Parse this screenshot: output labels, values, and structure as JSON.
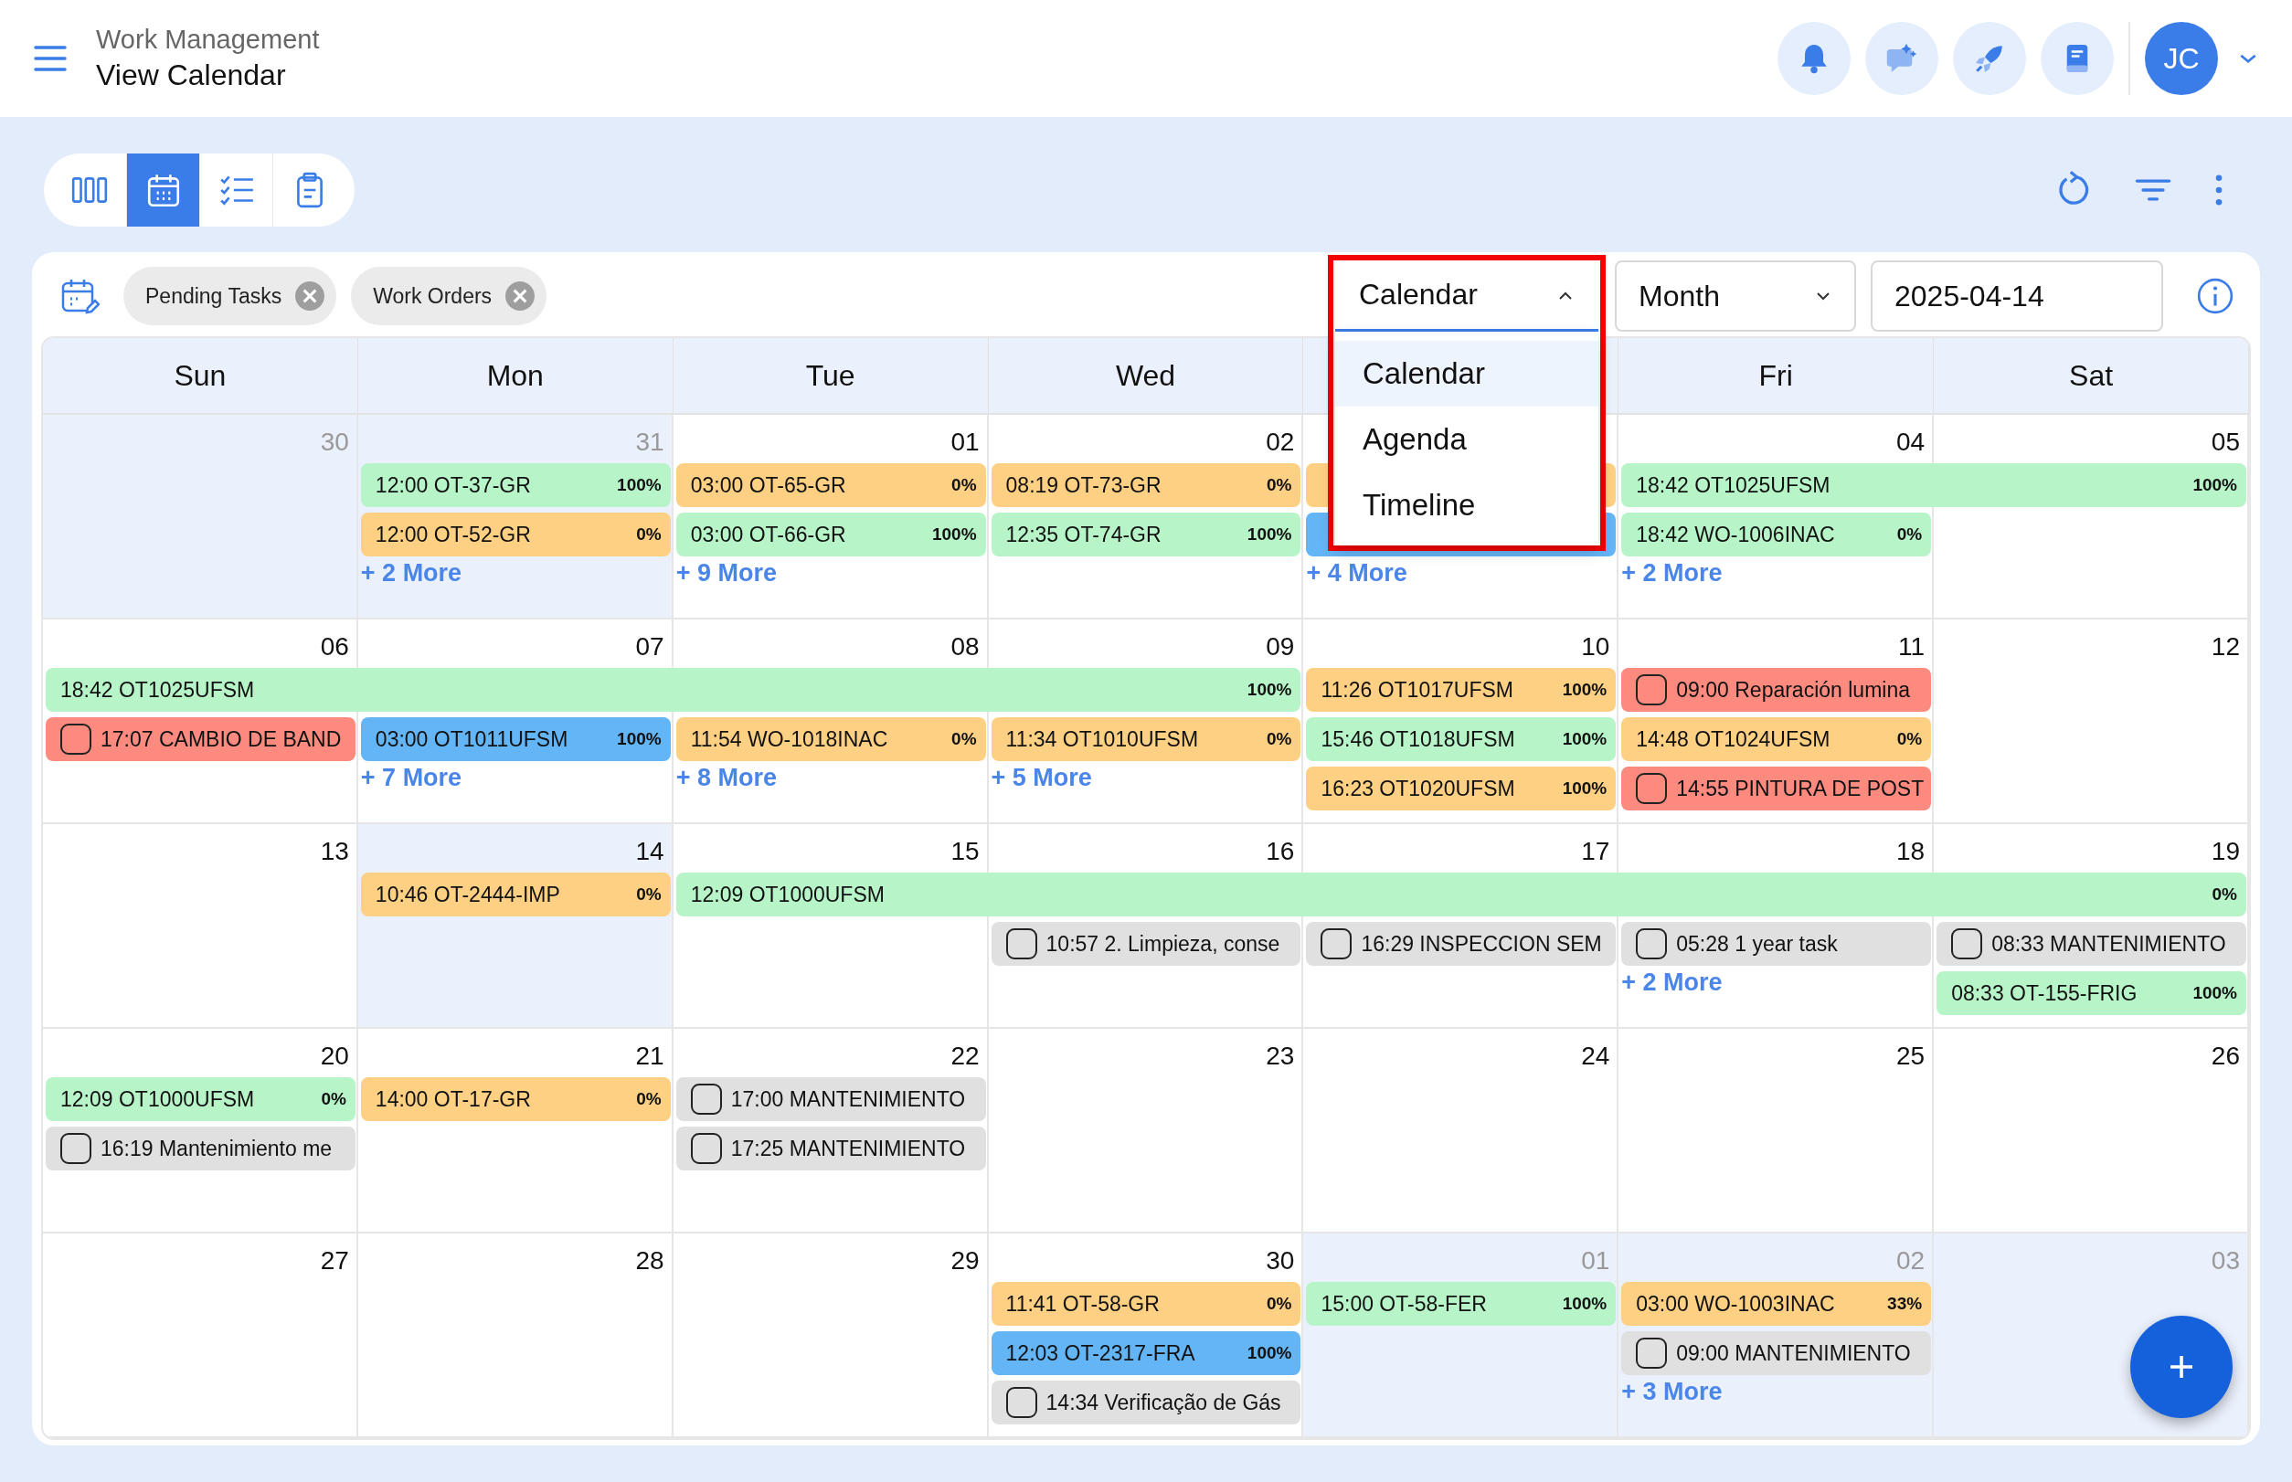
{
  "header": {
    "section": "Work Management",
    "title": "View Calendar",
    "avatar": "JC"
  },
  "view_buttons": [
    {
      "kind": "board",
      "selected": false
    },
    {
      "kind": "calendar",
      "selected": true
    },
    {
      "kind": "checklist",
      "selected": false
    },
    {
      "kind": "clipboard",
      "selected": false
    }
  ],
  "filter_chips": [
    {
      "label": "Pending Tasks"
    },
    {
      "label": "Work Orders"
    }
  ],
  "view_select": {
    "value": "Calendar",
    "expanded": true,
    "options": [
      {
        "label": "Calendar",
        "selected": true
      },
      {
        "label": "Agenda",
        "selected": false
      },
      {
        "label": "Timeline",
        "selected": false
      }
    ]
  },
  "range_select": {
    "value": "Month"
  },
  "date_field": {
    "value": "2025-04-14"
  },
  "weekdays": [
    {
      "kind": "label",
      "label": "Sun"
    },
    {
      "kind": "label",
      "label": "Mon"
    },
    {
      "kind": "label",
      "label": "Tue"
    },
    {
      "kind": "label",
      "label": "Wed"
    },
    {
      "kind": "covered"
    },
    {
      "kind": "label",
      "label": "Fri"
    },
    {
      "kind": "label",
      "label": "Sat"
    }
  ],
  "weeks": [
    {
      "days": [
        {
          "date": "30",
          "muted": true,
          "shaded": true
        },
        {
          "date": "31",
          "muted": true,
          "shaded": true,
          "events": [
            {
              "kind": "work_order",
              "color": "#b7f5c9",
              "title": "12:00 OT-37-GR",
              "percent": "100%"
            },
            {
              "kind": "work_order",
              "color": "#fdd083",
              "title": "12:00 OT-52-GR",
              "percent": "0%"
            }
          ],
          "more": "+ 2 More"
        },
        {
          "date": "01",
          "muted": false,
          "shaded": false,
          "events": [
            {
              "kind": "work_order",
              "color": "#fdd083",
              "title": "03:00 OT-65-GR",
              "percent": "0%"
            },
            {
              "kind": "work_order",
              "color": "#b7f5c9",
              "title": "03:00 OT-66-GR",
              "percent": "100%"
            }
          ],
          "more": "+ 9 More"
        },
        {
          "date": "02",
          "muted": false,
          "shaded": false,
          "events": [
            {
              "kind": "work_order",
              "color": "#fdd083",
              "title": "08:19 OT-73-GR",
              "percent": "0%"
            },
            {
              "kind": "work_order",
              "color": "#b7f5c9",
              "title": "12:35 OT-74-GR",
              "percent": "100%"
            }
          ]
        },
        {
          "shaded": false,
          "events": [
            {
              "kind": "work_order",
              "color": "#fdd083"
            },
            {
              "kind": "work_order",
              "color": "#64b5f6"
            }
          ],
          "more": "+ 4 More"
        },
        {
          "date": "04",
          "muted": false,
          "shaded": false,
          "events": [
            {
              "kind": "work_order",
              "color": "#b7f5c9",
              "title": "18:42 OT1025UFSM",
              "percent": "100%"
            },
            {
              "kind": "work_order",
              "color": "#b7f5c9",
              "title": "18:42 WO-1006INAC",
              "percent": "0%"
            }
          ],
          "more": "+ 2 More"
        },
        {
          "date": "05",
          "muted": false,
          "shaded": false,
          "continues": true
        }
      ]
    },
    {
      "days": [
        {
          "date": "06",
          "muted": false,
          "shaded": false,
          "events": [
            {
              "kind": "work_order",
              "color": "#b7f5c9",
              "title": "18:42 OT1025UFSM",
              "percent": "100%"
            },
            {
              "kind": "task",
              "color": "#fc8a7e",
              "title": "17:07 CAMBIO DE BAND",
              "checked": false
            }
          ]
        },
        {
          "date": "07",
          "muted": false,
          "shaded": false,
          "continues": true,
          "events": [
            {
              "kind": "work_order",
              "color": "#64b5f6",
              "title": "03:00 OT1011UFSM",
              "percent": "100%"
            }
          ],
          "more": "+ 7 More"
        },
        {
          "date": "08",
          "muted": false,
          "shaded": false,
          "continues": true,
          "events": [
            {
              "kind": "work_order",
              "color": "#fdd083",
              "title": "11:54 WO-1018INAC",
              "percent": "0%"
            }
          ],
          "more": "+ 8 More"
        },
        {
          "date": "09",
          "muted": false,
          "shaded": false,
          "continues": true,
          "events": [
            {
              "kind": "work_order",
              "color": "#fdd083",
              "title": "11:34 OT1010UFSM",
              "percent": "0%"
            }
          ],
          "more": "+ 5 More"
        },
        {
          "date": "10",
          "muted": false,
          "shaded": false,
          "events": [
            {
              "kind": "work_order",
              "color": "#fdd083",
              "title": "11:26 OT1017UFSM",
              "percent": "100%"
            },
            {
              "kind": "work_order",
              "color": "#b7f5c9",
              "title": "15:46 OT1018UFSM",
              "percent": "100%"
            },
            {
              "kind": "work_order",
              "color": "#fdd083",
              "title": "16:23 OT1020UFSM",
              "percent": "100%"
            }
          ]
        },
        {
          "date": "11",
          "muted": false,
          "shaded": false,
          "events": [
            {
              "kind": "task",
              "color": "#fc8a7e",
              "title": "09:00 Reparación lumina",
              "checked": false
            },
            {
              "kind": "work_order",
              "color": "#fdd083",
              "title": "14:48 OT1024UFSM",
              "percent": "0%"
            },
            {
              "kind": "task",
              "color": "#fc8a7e",
              "title": "14:55 PINTURA DE POST",
              "checked": false
            }
          ]
        },
        {
          "date": "12",
          "muted": false,
          "shaded": false
        }
      ]
    },
    {
      "days": [
        {
          "date": "13",
          "muted": false,
          "shaded": false
        },
        {
          "date": "14",
          "muted": false,
          "shaded": true,
          "events": [
            {
              "kind": "work_order",
              "color": "#fdd083",
              "title": "10:46 OT-2444-IMP",
              "percent": "0%"
            }
          ]
        },
        {
          "date": "15",
          "muted": false,
          "shaded": false,
          "events": [
            {
              "kind": "work_order",
              "color": "#b7f5c9",
              "title": "12:09 OT1000UFSM",
              "percent": "0%"
            }
          ]
        },
        {
          "date": "16",
          "muted": false,
          "shaded": false,
          "continues": true,
          "events": [
            {
              "kind": "task",
              "color": "#e0e0e0",
              "title": "10:57 2. Limpieza, conse",
              "checked": false
            }
          ]
        },
        {
          "date": "17",
          "muted": false,
          "shaded": false,
          "continues": true,
          "events": [
            {
              "kind": "task",
              "color": "#e0e0e0",
              "title": "16:29 INSPECCION SEM",
              "checked": false
            }
          ]
        },
        {
          "date": "18",
          "muted": false,
          "shaded": false,
          "continues": true,
          "events": [
            {
              "kind": "task",
              "color": "#e0e0e0",
              "title": "05:28 1 year task",
              "checked": false
            }
          ],
          "more": "+ 2 More"
        },
        {
          "date": "19",
          "muted": false,
          "shaded": false,
          "continues": true,
          "events": [
            {
              "kind": "task",
              "color": "#e0e0e0",
              "title": "08:33 MANTENIMIENTO",
              "checked": false
            },
            {
              "kind": "work_order",
              "color": "#b7f5c9",
              "title": "08:33 OT-155-FRIG",
              "percent": "100%"
            }
          ]
        }
      ]
    },
    {
      "days": [
        {
          "date": "20",
          "muted": false,
          "shaded": false,
          "events": [
            {
              "kind": "work_order",
              "color": "#b7f5c9",
              "title": "12:09 OT1000UFSM",
              "percent": "0%"
            },
            {
              "kind": "task",
              "color": "#e0e0e0",
              "title": "16:19 Mantenimiento me",
              "checked": false
            }
          ]
        },
        {
          "date": "21",
          "muted": false,
          "shaded": false,
          "events": [
            {
              "kind": "work_order",
              "color": "#fdd083",
              "title": "14:00 OT-17-GR",
              "percent": "0%"
            }
          ]
        },
        {
          "date": "22",
          "muted": false,
          "shaded": false,
          "events": [
            {
              "kind": "task",
              "color": "#e0e0e0",
              "title": "17:00 MANTENIMIENTO",
              "checked": false
            },
            {
              "kind": "task",
              "color": "#e0e0e0",
              "title": "17:25 MANTENIMIENTO",
              "checked": false
            }
          ]
        },
        {
          "date": "23",
          "muted": false,
          "shaded": false
        },
        {
          "date": "24",
          "muted": false,
          "shaded": false
        },
        {
          "date": "25",
          "muted": false,
          "shaded": false
        },
        {
          "date": "26",
          "muted": false,
          "shaded": false
        }
      ]
    },
    {
      "days": [
        {
          "date": "27",
          "muted": false,
          "shaded": false
        },
        {
          "date": "28",
          "muted": false,
          "shaded": false
        },
        {
          "date": "29",
          "muted": false,
          "shaded": false
        },
        {
          "date": "30",
          "muted": false,
          "shaded": false,
          "events": [
            {
              "kind": "work_order",
              "color": "#fdd083",
              "title": "11:41 OT-58-GR",
              "percent": "0%"
            },
            {
              "kind": "work_order",
              "color": "#64b5f6",
              "title": "12:03 OT-2317-FRA",
              "percent": "100%"
            },
            {
              "kind": "task",
              "color": "#e0e0e0",
              "title": "14:34 Verificação de Gás",
              "checked": false
            }
          ]
        },
        {
          "date": "01",
          "muted": true,
          "shaded": true,
          "events": [
            {
              "kind": "work_order",
              "color": "#b7f5c9",
              "title": "15:00 OT-58-FER",
              "percent": "100%"
            }
          ]
        },
        {
          "date": "02",
          "muted": true,
          "shaded": true,
          "events": [
            {
              "kind": "work_order",
              "color": "#fdd083",
              "title": "03:00 WO-1003INAC",
              "percent": "33%"
            },
            {
              "kind": "task",
              "color": "#e0e0e0",
              "title": "09:00 MANTENIMIENTO",
              "checked": false
            }
          ],
          "more": "+ 3 More"
        },
        {
          "date": "03",
          "muted": true,
          "shaded": true
        }
      ]
    }
  ]
}
